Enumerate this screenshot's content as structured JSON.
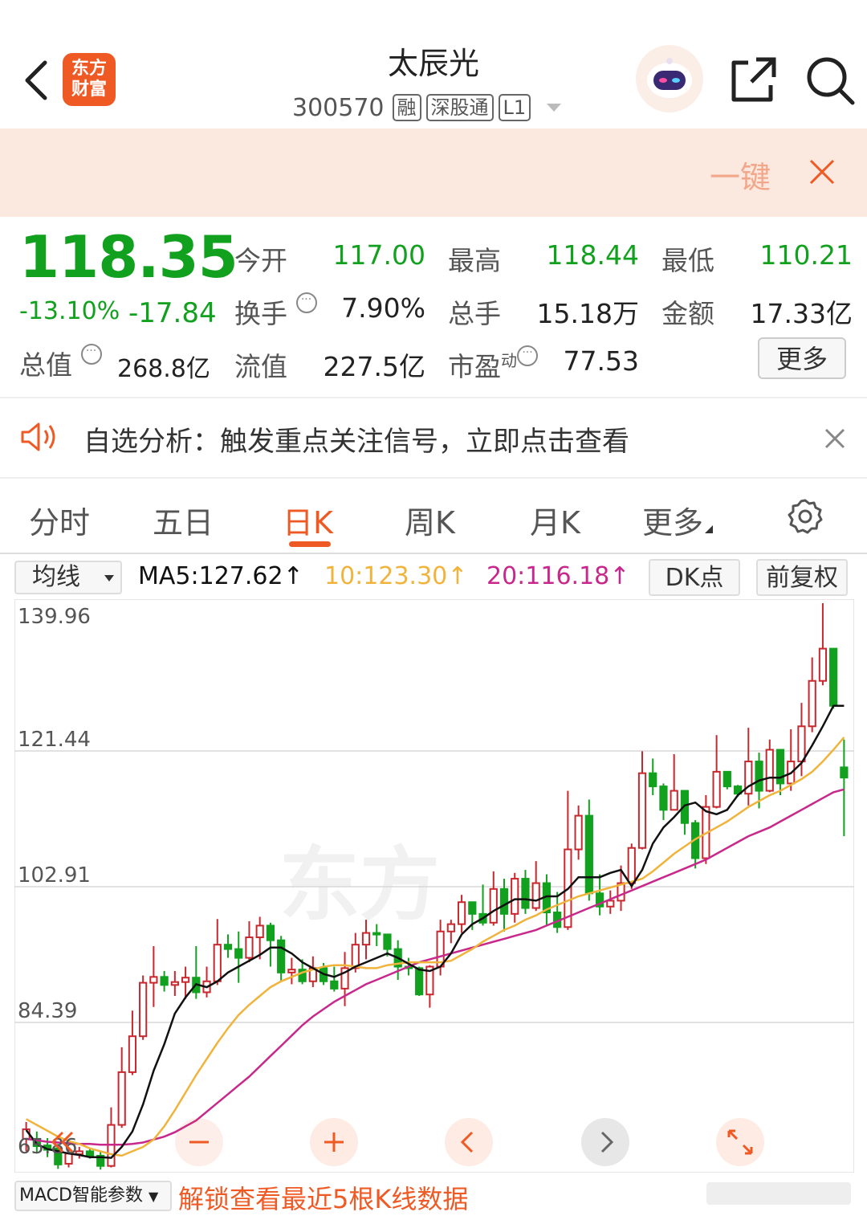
{
  "header": {
    "logo_line1": "东方",
    "logo_line2": "财富",
    "title": "太辰光",
    "code": "300570",
    "tags": [
      "融",
      "深股通",
      "L1"
    ]
  },
  "banner": {
    "text": "一键"
  },
  "quote": {
    "price": "118.35",
    "change_pct": "-13.10%",
    "change": "-17.84",
    "total_value_label": "总值",
    "total_value": "268.8亿",
    "fields": [
      {
        "label": "今开",
        "value": "117.00"
      },
      {
        "label": "最高",
        "value": "118.44"
      },
      {
        "label": "最低",
        "value": "110.21"
      },
      {
        "label": "换手",
        "value": "7.90%"
      },
      {
        "label": "总手",
        "value": "15.18万"
      },
      {
        "label": "金额",
        "value": "17.33亿"
      },
      {
        "label": "流值",
        "value": "227.5亿"
      },
      {
        "label": "市盈",
        "sup": "动",
        "value": "77.53"
      }
    ],
    "more_label": "更多"
  },
  "analysis": {
    "text": "自选分析：触发重点关注信号，立即点击查看"
  },
  "tabs": [
    {
      "label": "分时"
    },
    {
      "label": "五日"
    },
    {
      "label": "日K"
    },
    {
      "label": "周K"
    },
    {
      "label": "月K"
    },
    {
      "label": "更多"
    }
  ],
  "chart_toolbar": {
    "ma_select": "均线",
    "ma5": "MA5:127.62",
    "ma10": "10:123.30",
    "ma20": "20:116.18",
    "dk": "DK点",
    "fq": "前复权"
  },
  "colors": {
    "accent": "#ef5a24",
    "down": "#12a11e",
    "up": "#c8282d",
    "ma5": "#111111",
    "ma10": "#f0b43c",
    "ma20": "#c8288c"
  },
  "chart_data": {
    "type": "candlestick",
    "y_ticks": [
      "139.96",
      "121.44",
      "102.91",
      "84.39",
      "65.86"
    ],
    "ylim": [
      65.86,
      139.96
    ],
    "grid": true,
    "candles": [
      [
        68.5,
        69.8,
        66.8,
        70.8
      ],
      [
        68.5,
        67.5,
        66.5,
        69.5
      ],
      [
        67.6,
        67.0,
        66.0,
        68.6
      ],
      [
        67.2,
        65.0,
        64.4,
        67.8
      ],
      [
        65.1,
        66.5,
        64.6,
        67.3
      ],
      [
        66.4,
        66.8,
        65.8,
        67.4
      ],
      [
        66.8,
        66.2,
        65.8,
        67.2
      ],
      [
        66.2,
        64.8,
        64.3,
        66.7
      ],
      [
        64.8,
        70.4,
        64.6,
        72.8
      ],
      [
        70.4,
        77.6,
        70.0,
        81.0
      ],
      [
        77.6,
        82.5,
        77.2,
        86.0
      ],
      [
        82.5,
        89.8,
        82.0,
        90.8
      ],
      [
        89.8,
        90.6,
        86.5,
        94.8
      ],
      [
        90.6,
        89.5,
        88.6,
        91.4
      ],
      [
        89.5,
        89.9,
        88.0,
        91.4
      ],
      [
        89.9,
        90.5,
        87.6,
        92.0
      ],
      [
        90.5,
        88.5,
        87.6,
        94.8
      ],
      [
        88.5,
        90.0,
        87.8,
        92.0
      ],
      [
        90.0,
        95.0,
        89.5,
        98.5
      ],
      [
        95.0,
        94.4,
        93.2,
        96.4
      ],
      [
        94.4,
        93.2,
        89.8,
        96.8
      ],
      [
        93.2,
        96.0,
        92.6,
        98.2
      ],
      [
        96.0,
        97.6,
        93.0,
        98.8
      ],
      [
        97.6,
        95.6,
        92.0,
        98.0
      ],
      [
        95.6,
        91.2,
        90.0,
        96.2
      ],
      [
        91.2,
        91.6,
        89.6,
        93.2
      ],
      [
        91.6,
        90.0,
        89.6,
        93.0
      ],
      [
        90.0,
        91.8,
        89.2,
        93.4
      ],
      [
        91.8,
        90.0,
        89.5,
        92.5
      ],
      [
        90.0,
        89.0,
        88.6,
        92.0
      ],
      [
        89.0,
        91.8,
        86.6,
        94.0
      ],
      [
        91.8,
        95.0,
        91.2,
        96.6
      ],
      [
        95.0,
        96.6,
        93.0,
        98.4
      ],
      [
        96.6,
        96.4,
        94.8,
        97.8
      ],
      [
        96.4,
        94.4,
        93.4,
        96.4
      ],
      [
        94.4,
        92.0,
        90.2,
        95.6
      ],
      [
        92.0,
        91.8,
        90.8,
        93.2
      ],
      [
        91.8,
        88.2,
        88.0,
        92.0
      ],
      [
        88.2,
        92.0,
        86.4,
        92.2
      ],
      [
        92.0,
        96.8,
        90.8,
        98.4
      ],
      [
        96.8,
        97.8,
        95.2,
        98.4
      ],
      [
        97.8,
        100.8,
        96.6,
        101.8
      ],
      [
        100.8,
        99.2,
        97.0,
        100.8
      ],
      [
        99.2,
        98.0,
        97.6,
        103.2
      ],
      [
        98.0,
        102.6,
        97.6,
        105.0
      ],
      [
        102.6,
        99.2,
        96.8,
        104.0
      ],
      [
        99.2,
        104.0,
        98.0,
        104.8
      ],
      [
        104.0,
        100.0,
        99.2,
        105.2
      ],
      [
        100.0,
        103.4,
        99.6,
        106.4
      ],
      [
        103.4,
        99.4,
        97.6,
        104.6
      ],
      [
        99.4,
        97.4,
        96.6,
        102.2
      ],
      [
        97.4,
        108.0,
        97.0,
        116.0
      ],
      [
        108.0,
        112.6,
        106.6,
        114.0
      ],
      [
        112.6,
        102.0,
        101.0,
        114.8
      ],
      [
        102.0,
        100.2,
        99.0,
        104.6
      ],
      [
        100.2,
        101.0,
        99.2,
        102.4
      ],
      [
        101.0,
        103.4,
        99.6,
        105.8
      ],
      [
        103.4,
        108.2,
        102.6,
        108.8
      ],
      [
        108.2,
        118.4,
        108.0,
        121.4
      ],
      [
        118.4,
        116.6,
        115.4,
        120.4
      ],
      [
        116.6,
        113.4,
        112.0,
        117.0
      ],
      [
        113.4,
        116.0,
        114.0,
        121.0
      ],
      [
        116.0,
        111.6,
        110.0,
        113.0
      ],
      [
        111.6,
        106.8,
        105.4,
        112.0
      ],
      [
        106.8,
        113.8,
        106.0,
        115.4
      ],
      [
        113.8,
        118.6,
        113.6,
        123.6
      ],
      [
        118.6,
        116.6,
        116.2,
        118.0
      ],
      [
        116.6,
        115.6,
        115.2,
        116.8
      ],
      [
        115.6,
        120.0,
        114.0,
        124.6
      ],
      [
        120.0,
        116.0,
        113.6,
        121.2
      ],
      [
        116.0,
        121.6,
        115.8,
        123.0
      ],
      [
        121.6,
        117.0,
        115.4,
        117.8
      ],
      [
        117.0,
        120.0,
        116.0,
        124.4
      ],
      [
        120.0,
        124.8,
        118.0,
        128.0
      ],
      [
        124.8,
        131.0,
        124.0,
        134.2
      ],
      [
        131.0,
        135.4,
        130.4,
        141.6
      ],
      [
        135.4,
        127.6,
        127.2,
        128.2
      ],
      [
        119.2,
        117.8,
        109.8,
        123.0
      ]
    ],
    "ma5": [
      69.7,
      67.8,
      67.1,
      66.8,
      66.5,
      66.3,
      66.0,
      66.0,
      65.9,
      67.4,
      69.5,
      73.2,
      77.8,
      81.4,
      85.6,
      87.8,
      89.6,
      89.2,
      90.0,
      91.2,
      92.0,
      92.8,
      93.6,
      94.6,
      94.6,
      93.8,
      92.6,
      91.8,
      91.0,
      90.6,
      91.2,
      92.0,
      92.6,
      93.2,
      93.8,
      93.2,
      92.4,
      91.6,
      91.4,
      92.0,
      93.8,
      96.4,
      97.8,
      98.6,
      99.6,
      100.4,
      101.2,
      101.2,
      101.0,
      101.6,
      101.6,
      102.6,
      104.2,
      104.2,
      104.2,
      104.8,
      105.2,
      103.0,
      105.2,
      108.8,
      111.0,
      112.4,
      114.0,
      114.4,
      113.2,
      112.8,
      113.4,
      115.4,
      116.6,
      117.4,
      117.8,
      117.8,
      118.4,
      119.8,
      122.2,
      124.8,
      127.6,
      127.6
    ],
    "ma10": [
      71.2,
      70.4,
      69.6,
      68.8,
      68.2,
      67.8,
      67.2,
      66.8,
      66.4,
      66.2,
      66.8,
      67.4,
      68.4,
      70.2,
      72.4,
      74.8,
      77.2,
      79.4,
      81.6,
      83.6,
      85.4,
      86.8,
      88.0,
      89.2,
      90.0,
      90.6,
      91.2,
      91.6,
      92.0,
      92.2,
      92.2,
      92.0,
      91.8,
      91.8,
      92.2,
      92.4,
      92.6,
      92.6,
      92.6,
      92.6,
      92.8,
      93.6,
      94.4,
      95.4,
      96.2,
      97.0,
      97.6,
      98.4,
      99.0,
      99.8,
      100.4,
      101.0,
      101.6,
      102.0,
      102.4,
      102.8,
      103.2,
      103.6,
      104.0,
      105.0,
      106.2,
      107.4,
      108.4,
      109.4,
      110.2,
      111.0,
      111.8,
      112.8,
      113.8,
      114.6,
      115.4,
      116.0,
      116.8,
      117.6,
      118.6,
      120.0,
      121.6,
      123.3
    ],
    "ma20": [
      68.5,
      68.3,
      68.1,
      68.0,
      67.9,
      67.8,
      67.8,
      67.7,
      67.7,
      67.7,
      67.8,
      68.0,
      68.4,
      68.8,
      69.4,
      70.2,
      71.0,
      72.2,
      73.4,
      74.6,
      75.8,
      77.0,
      78.4,
      79.8,
      81.2,
      82.6,
      84.0,
      85.2,
      86.2,
      87.2,
      88.0,
      88.8,
      89.6,
      90.2,
      90.8,
      91.4,
      92.0,
      92.6,
      93.0,
      93.4,
      93.8,
      94.2,
      94.6,
      95.0,
      95.4,
      95.8,
      96.2,
      96.6,
      97.0,
      97.6,
      98.2,
      98.8,
      99.4,
      100.0,
      100.6,
      101.2,
      101.8,
      102.4,
      103.0,
      103.6,
      104.2,
      104.8,
      105.4,
      106.0,
      106.6,
      107.4,
      108.2,
      109.0,
      109.8,
      110.4,
      111.0,
      111.8,
      112.6,
      113.4,
      114.2,
      115.0,
      115.8,
      116.2
    ]
  },
  "bottom": {
    "macd_select": "MACD智能参数",
    "unlock": "解锁查看最近5根K线数据"
  }
}
